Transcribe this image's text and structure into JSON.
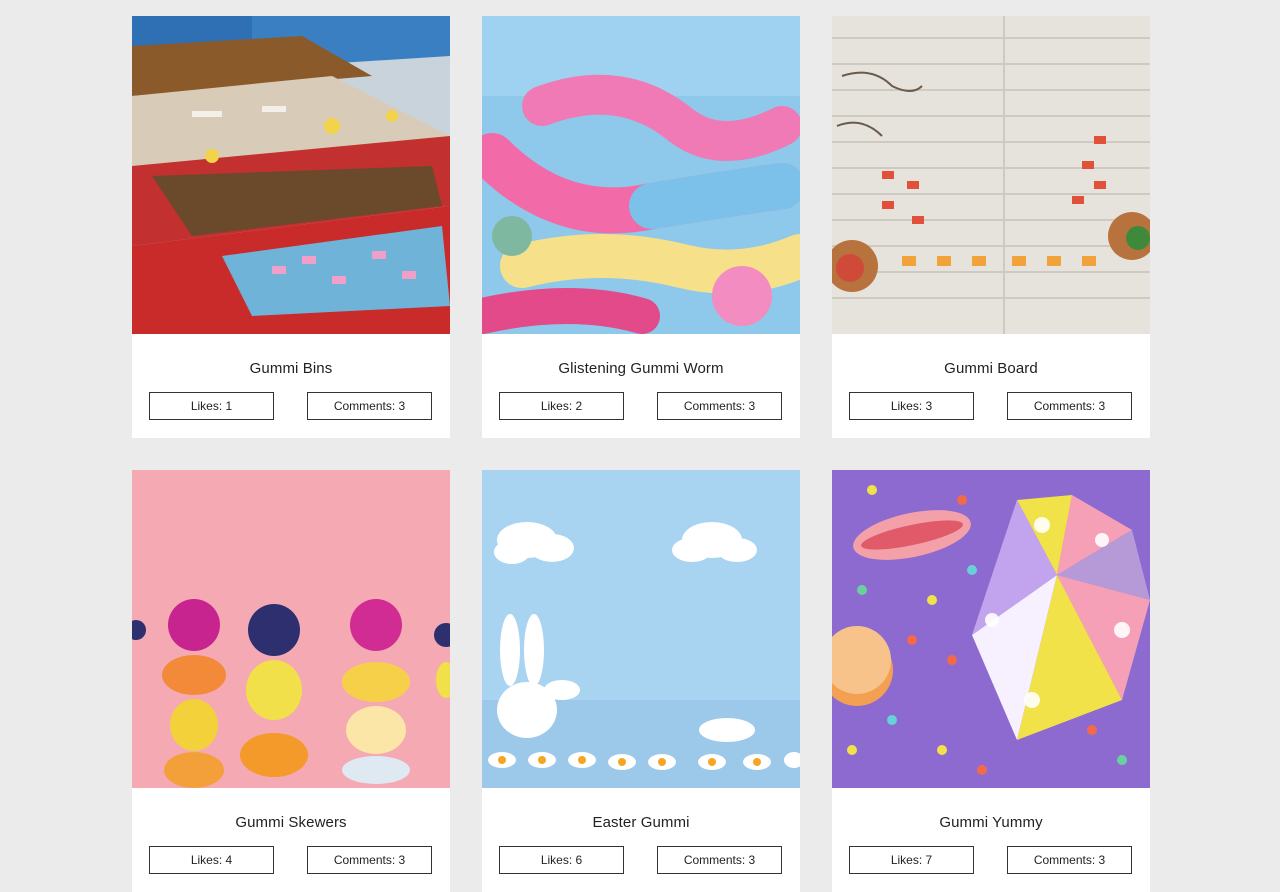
{
  "gallery": {
    "items": [
      {
        "title": "Gummi Bins",
        "likes": "Likes: 1",
        "comments": "Comments: 3",
        "image": "candy-bins-photo"
      },
      {
        "title": "Glistening Gummi Worm",
        "likes": "Likes: 2",
        "comments": "Comments: 3",
        "image": "gummi-worms-photo"
      },
      {
        "title": "Gummi Board",
        "likes": "Likes: 3",
        "comments": "Comments: 3",
        "image": "gummi-board-photo"
      },
      {
        "title": "Gummi Skewers",
        "likes": "Likes: 4",
        "comments": "Comments: 3",
        "image": "gummi-skewers-photo"
      },
      {
        "title": "Easter Gummi",
        "likes": "Likes: 6",
        "comments": "Comments: 3",
        "image": "easter-gummi-photo"
      },
      {
        "title": "Gummi Yummy",
        "likes": "Likes: 7",
        "comments": "Comments: 3",
        "image": "gummi-yummy-photo"
      }
    ]
  },
  "colors": {
    "page_background": "#ebebeb",
    "card_background": "#ffffff",
    "button_border": "#333333"
  }
}
